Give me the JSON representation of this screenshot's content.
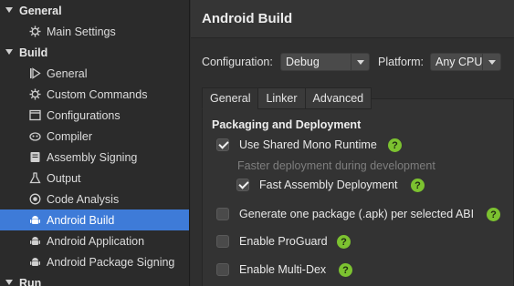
{
  "sidebar": {
    "groups": [
      {
        "label": "General"
      },
      {
        "label": "Build"
      },
      {
        "label": "Run"
      }
    ],
    "general_items": [
      {
        "label": "Main Settings",
        "icon": "gear-icon"
      }
    ],
    "build_items": [
      {
        "label": "General",
        "icon": "play-icon"
      },
      {
        "label": "Custom Commands",
        "icon": "gear-icon"
      },
      {
        "label": "Configurations",
        "icon": "window-icon"
      },
      {
        "label": "Compiler",
        "icon": "compiler-icon"
      },
      {
        "label": "Assembly Signing",
        "icon": "certificate-icon"
      },
      {
        "label": "Output",
        "icon": "flask-icon"
      },
      {
        "label": "Code Analysis",
        "icon": "target-icon"
      },
      {
        "label": "Android Build",
        "icon": "android-icon",
        "selected": true
      },
      {
        "label": "Android Application",
        "icon": "android-icon"
      },
      {
        "label": "Android Package Signing",
        "icon": "android-icon"
      }
    ]
  },
  "main": {
    "title": "Android Build",
    "configuration_label": "Configuration:",
    "configuration_value": "Debug",
    "platform_label": "Platform:",
    "platform_value": "Any CPU",
    "tabs": [
      {
        "label": "General",
        "active": true
      },
      {
        "label": "Linker"
      },
      {
        "label": "Advanced"
      }
    ],
    "section_title": "Packaging and Deployment",
    "options": {
      "shared_runtime": {
        "label": "Use Shared Mono Runtime",
        "checked": true
      },
      "shared_runtime_hint": "Faster deployment during development",
      "fast_deploy": {
        "label": "Fast Assembly Deployment",
        "checked": true
      },
      "per_abi": {
        "label": "Generate one package (.apk) per selected ABI",
        "checked": false
      },
      "proguard": {
        "label": "Enable ProGuard",
        "checked": false
      },
      "multidex": {
        "label": "Enable Multi-Dex",
        "checked": false
      }
    },
    "help_glyph": "?"
  },
  "colors": {
    "selection": "#3e7bd8",
    "help_badge": "#7cc230"
  }
}
